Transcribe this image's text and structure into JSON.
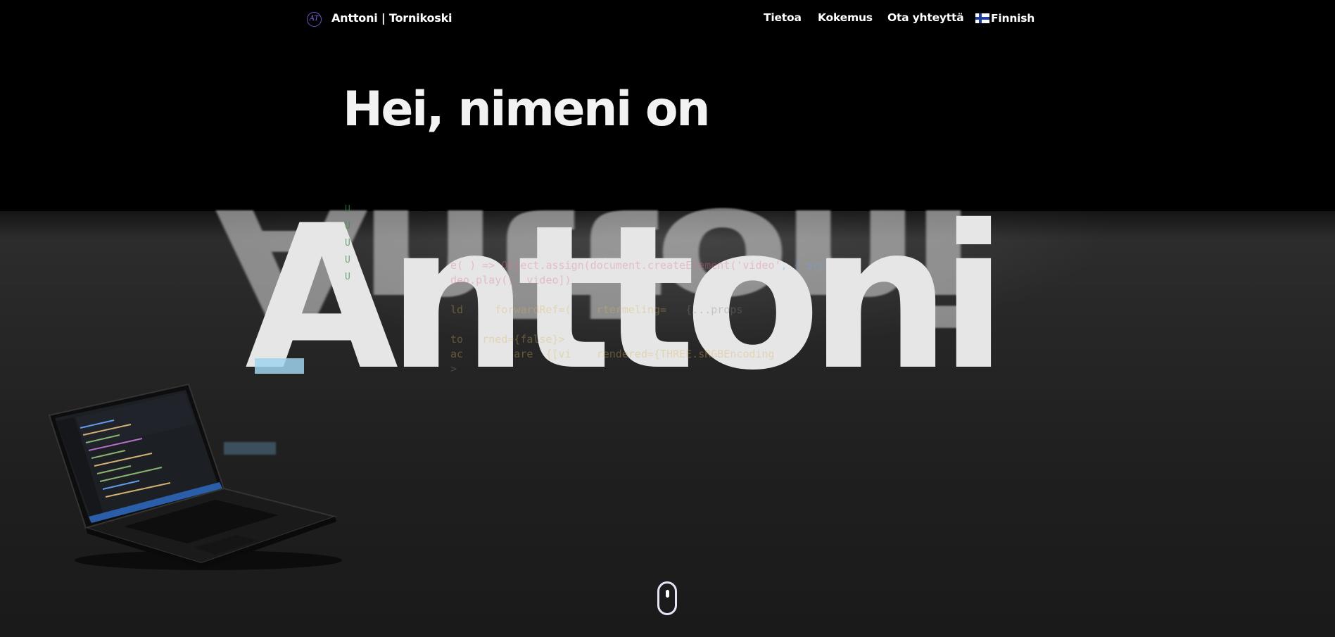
{
  "brand": {
    "badge": "AT",
    "name": "Anttoni | Tornikoski"
  },
  "nav": {
    "items": [
      {
        "label": "Tietoa"
      },
      {
        "label": "Kokemus"
      },
      {
        "label": "Ota yhteyttä"
      }
    ],
    "language": {
      "label": "Finnish",
      "flag": "finland-flag-icon"
    }
  },
  "hero": {
    "greeting": "Hei, nimeni on",
    "name": "Anttoni"
  },
  "colors": {
    "background": "#000000",
    "accent": "#6d52c9",
    "text": "#ffffff"
  }
}
